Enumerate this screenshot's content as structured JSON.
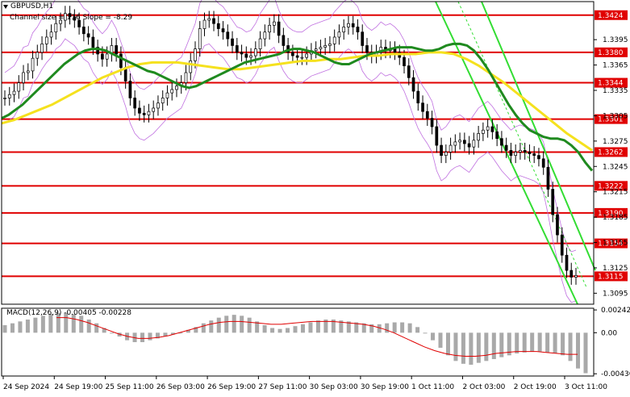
{
  "header": {
    "symbol_timeframe": "GBPUSD,H1",
    "indicator_label": "Channel size = 116  Slope = -8.29"
  },
  "macd": {
    "label": "MACD(12,26,9) -0.00405 -0.00228",
    "ticks": [
      "0.00242",
      "0.00",
      "-0.00436"
    ]
  },
  "price_axis": {
    "ticks": [
      "1.3395",
      "1.3365",
      "1.3335",
      "1.3305",
      "1.3275",
      "1.3245",
      "1.3215",
      "1.3185",
      "1.3155",
      "1.3125",
      "1.3095"
    ]
  },
  "levels": [
    {
      "label": "1.3424",
      "value": 1.3424
    },
    {
      "label": "1.3380",
      "value": 1.338
    },
    {
      "label": "1.3344",
      "value": 1.3344
    },
    {
      "label": "1.3301",
      "value": 1.3301
    },
    {
      "label": "1.3262",
      "value": 1.3262
    },
    {
      "label": "1.3222",
      "value": 1.3222
    },
    {
      "label": "1.3190",
      "value": 1.319
    },
    {
      "label": "1.3154",
      "value": 1.3154
    },
    {
      "label": "1.3115",
      "value": 1.3115
    }
  ],
  "time_axis": {
    "labels": [
      "24 Sep 2024",
      "24 Sep 19:00",
      "25 Sep 11:00",
      "26 Sep 03:00",
      "26 Sep 19:00",
      "27 Sep 11:00",
      "30 Sep 03:00",
      "30 Sep 19:00",
      "1 Oct 11:00",
      "2 Oct 03:00",
      "2 Oct 19:00",
      "3 Oct 11:00"
    ]
  },
  "colors": {
    "level_line": "#e00000",
    "level_box": "#e00000",
    "ma_fast": "#1f8a1f",
    "ma_slow": "#f5e11e",
    "channel": "#33dd33",
    "envelope": "#c070e0",
    "macd_hist": "#a9a9a9",
    "macd_signal": "#e00000",
    "candles": "#000000"
  },
  "chart_data": {
    "type": "line",
    "title": "GBPUSD,H1",
    "price_range": [
      1.3082,
      1.344
    ],
    "macd_range": [
      -0.0046,
      0.0026
    ],
    "close": [
      1.3326,
      1.333,
      1.3334,
      1.3344,
      1.3356,
      1.3358,
      1.3373,
      1.338,
      1.339,
      1.3398,
      1.3404,
      1.3414,
      1.3418,
      1.3426,
      1.3422,
      1.3418,
      1.341,
      1.3402,
      1.3398,
      1.3386,
      1.3378,
      1.3372,
      1.3378,
      1.3388,
      1.3378,
      1.3362,
      1.3346,
      1.3326,
      1.3314,
      1.3308,
      1.3306,
      1.331,
      1.3314,
      1.332,
      1.3326,
      1.3332,
      1.3336,
      1.334,
      1.3344,
      1.3356,
      1.337,
      1.3384,
      1.3408,
      1.3418,
      1.342,
      1.3414,
      1.3408,
      1.3404,
      1.3396,
      1.3388,
      1.338,
      1.3378,
      1.3374,
      1.3376,
      1.3384,
      1.3396,
      1.3404,
      1.3412,
      1.3416,
      1.34,
      1.3388,
      1.338,
      1.3376,
      1.3374,
      1.3374,
      1.3378,
      1.3382,
      1.3384,
      1.3386,
      1.3388,
      1.339,
      1.3398,
      1.3404,
      1.341,
      1.3414,
      1.341,
      1.3404,
      1.3388,
      1.338,
      1.3376,
      1.338,
      1.3386,
      1.3382,
      1.3384,
      1.338,
      1.3374,
      1.3364,
      1.335,
      1.3334,
      1.332,
      1.331,
      1.3302,
      1.3292,
      1.327,
      1.3258,
      1.3262,
      1.327,
      1.3274,
      1.3276,
      1.3272,
      1.3268,
      1.3276,
      1.3284,
      1.3288,
      1.3292,
      1.3286,
      1.3278,
      1.327,
      1.3264,
      1.3258,
      1.3262,
      1.3264,
      1.3262,
      1.326,
      1.3258,
      1.3254,
      1.3244,
      1.3218,
      1.3188,
      1.3164,
      1.314,
      1.3122,
      1.3114,
      1.3116
    ],
    "ma_fast": [
      1.3302,
      1.3306,
      1.3312,
      1.3318,
      1.3326,
      1.3334,
      1.3342,
      1.335,
      1.3358,
      1.3366,
      1.3372,
      1.3378,
      1.3382,
      1.3384,
      1.3384,
      1.3382,
      1.3378,
      1.3374,
      1.337,
      1.3366,
      1.3362,
      1.3358,
      1.3356,
      1.3352,
      1.3348,
      1.3344,
      1.334,
      1.3338,
      1.334,
      1.3344,
      1.3348,
      1.3352,
      1.3356,
      1.336,
      1.3364,
      1.3368,
      1.337,
      1.3372,
      1.3374,
      1.3376,
      1.3378,
      1.3382,
      1.3384,
      1.3384,
      1.3382,
      1.338,
      1.3376,
      1.3372,
      1.3368,
      1.3366,
      1.3366,
      1.337,
      1.3374,
      1.3378,
      1.338,
      1.3382,
      1.3384,
      1.3386,
      1.3386,
      1.3386,
      1.3384,
      1.3382,
      1.3382,
      1.3384,
      1.3388,
      1.339,
      1.339,
      1.3388,
      1.3382,
      1.3372,
      1.336,
      1.3346,
      1.3332,
      1.3318,
      1.3306,
      1.3296,
      1.3288,
      1.3284,
      1.328,
      1.3278,
      1.3278,
      1.3276,
      1.327,
      1.3262,
      1.325,
      1.324
    ],
    "ma_slow": [
      1.3296,
      1.33,
      1.3306,
      1.3312,
      1.3318,
      1.3326,
      1.3334,
      1.3342,
      1.335,
      1.3356,
      1.3362,
      1.3366,
      1.3368,
      1.3368,
      1.3368,
      1.3366,
      1.3364,
      1.3362,
      1.336,
      1.336,
      1.3362,
      1.3364,
      1.3366,
      1.3368,
      1.337,
      1.337,
      1.3372,
      1.3372,
      1.3374,
      1.3376,
      1.3376,
      1.3378,
      1.3378,
      1.3378,
      1.338,
      1.338,
      1.3378,
      1.3372,
      1.3364,
      1.3354,
      1.3344,
      1.3332,
      1.332,
      1.3308,
      1.3296,
      1.3284,
      1.3274,
      1.3264
    ],
    "macd_hist": [
      0.0008,
      0.001,
      0.0012,
      0.0014,
      0.0016,
      0.0018,
      0.002,
      0.0021,
      0.0021,
      0.002,
      0.0018,
      0.0014,
      0.001,
      0.0005,
      0.0,
      -0.0004,
      -0.0008,
      -0.001,
      -0.001,
      -0.0008,
      -0.0006,
      -0.0004,
      -0.0002,
      0.0,
      0.0003,
      0.0006,
      0.001,
      0.0013,
      0.0016,
      0.0018,
      0.0019,
      0.0018,
      0.0016,
      0.0012,
      0.0008,
      0.0005,
      0.0004,
      0.0005,
      0.0007,
      0.0009,
      0.0011,
      0.0013,
      0.0014,
      0.0014,
      0.0013,
      0.0012,
      0.0011,
      0.001,
      0.0009,
      0.0009,
      0.001,
      0.0011,
      0.0011,
      0.001,
      0.0006,
      0.0,
      -0.0008,
      -0.0016,
      -0.0024,
      -0.003,
      -0.0033,
      -0.0034,
      -0.0032,
      -0.003,
      -0.0028,
      -0.0026,
      -0.0024,
      -0.0022,
      -0.0021,
      -0.002,
      -0.002,
      -0.0021,
      -0.0022,
      -0.0024,
      -0.003,
      -0.0038,
      -0.0043
    ],
    "macd_signal": [
      0.0016,
      0.0016,
      0.0014,
      0.0011,
      0.0007,
      0.0003,
      -0.0001,
      -0.0004,
      -0.0006,
      -0.0006,
      -0.0005,
      -0.0003,
      0.0,
      0.0003,
      0.0006,
      0.0009,
      0.0011,
      0.0012,
      0.0012,
      0.0011,
      0.001,
      0.0009,
      0.0009,
      0.001,
      0.0011,
      0.0012,
      0.0012,
      0.0012,
      0.0011,
      0.001,
      0.0009,
      0.0007,
      0.0004,
      0.0,
      -0.0005,
      -0.001,
      -0.0015,
      -0.0019,
      -0.0022,
      -0.0024,
      -0.0025,
      -0.0025,
      -0.0024,
      -0.0022,
      -0.0021,
      -0.002,
      -0.002,
      -0.002,
      -0.0021,
      -0.0022,
      -0.0023,
      -0.0023
    ]
  }
}
